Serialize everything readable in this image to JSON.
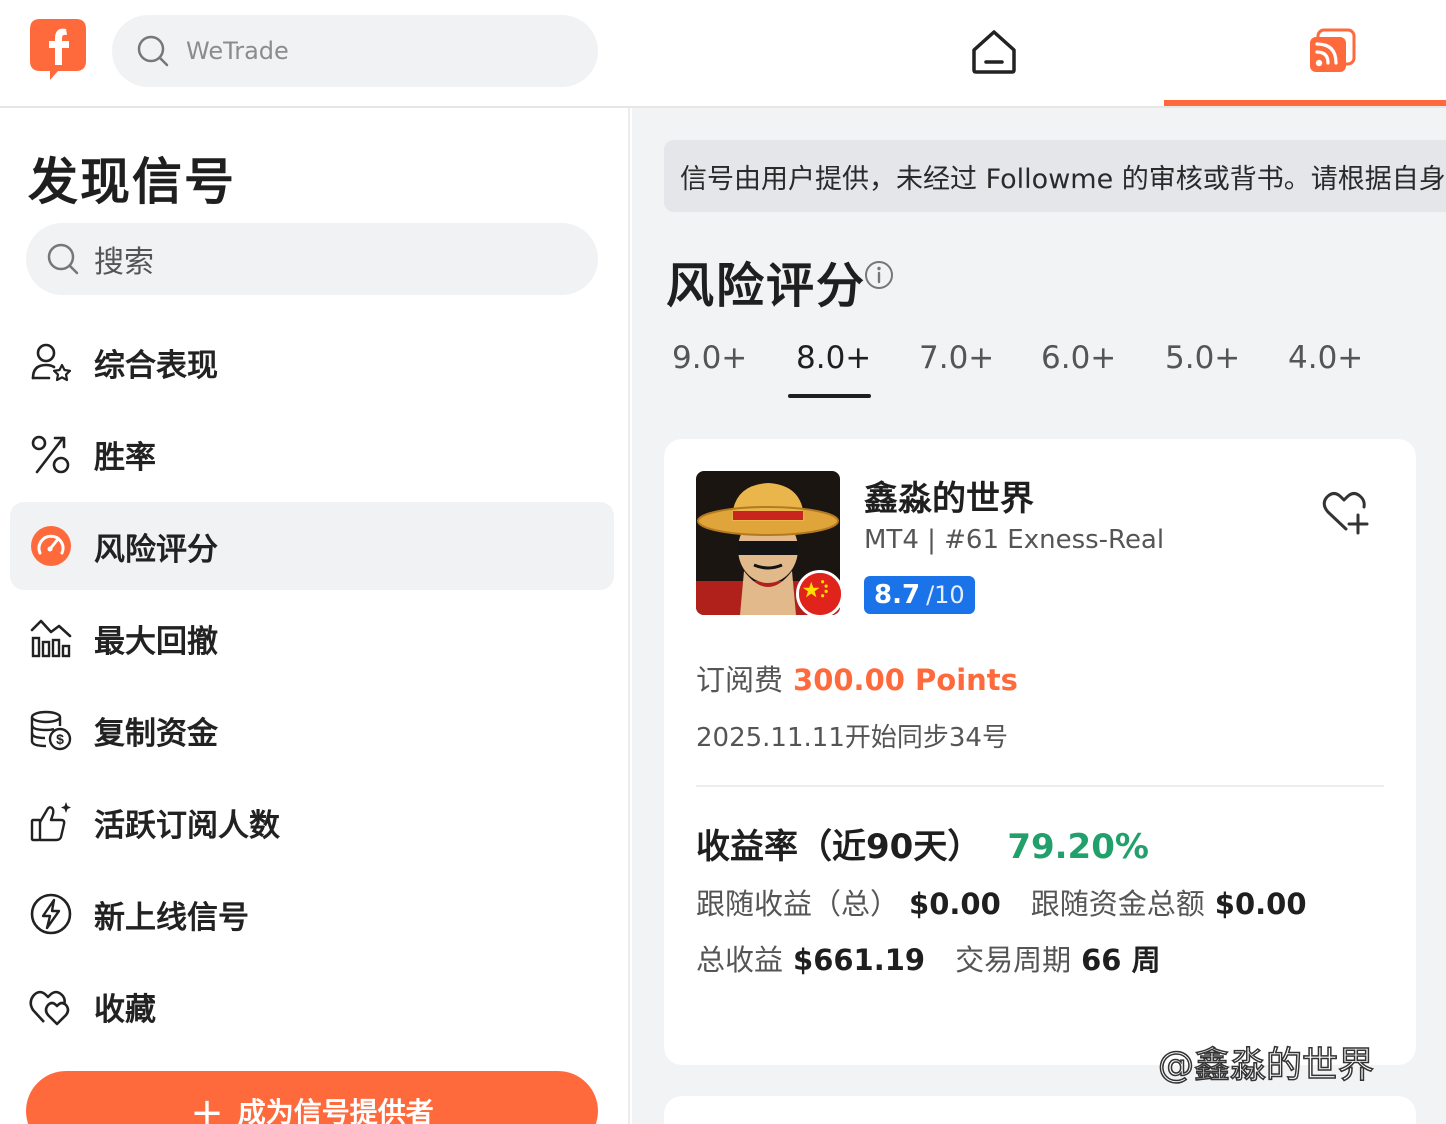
{
  "topbar": {
    "search_placeholder": "WeTrade"
  },
  "sidebar": {
    "title": "发现信号",
    "search_placeholder": "搜索",
    "items": [
      {
        "label": "综合表现",
        "icon": "user-star-icon"
      },
      {
        "label": "胜率",
        "icon": "percent-icon"
      },
      {
        "label": "风险评分",
        "icon": "speedometer-icon",
        "active": true
      },
      {
        "label": "最大回撤",
        "icon": "chart-drawdown-icon"
      },
      {
        "label": "复制资金",
        "icon": "coins-icon"
      },
      {
        "label": "活跃订阅人数",
        "icon": "thumbs-up-icon"
      },
      {
        "label": "新上线信号",
        "icon": "lightning-icon"
      },
      {
        "label": "收藏",
        "icon": "heart-icon"
      }
    ],
    "cta_label": "成为信号提供者"
  },
  "main": {
    "notice": "信号由用户提供，未经过 Followme 的审核或背书。请根据自身",
    "title": "风险评分",
    "score_tabs": [
      "9.0+",
      "8.0+",
      "7.0+",
      "6.0+",
      "5.0+",
      "4.0+"
    ],
    "active_tab": "8.0+",
    "card": {
      "name": "鑫淼的世界",
      "account": "MT4 | #61 Exness-Real",
      "score": "8.7",
      "score_max": "/10",
      "fee_label": "订阅费",
      "fee_value": "300.00 Points",
      "description": "2025.11.11开始同步34号",
      "return_label": "收益率（近90天）",
      "return_value": "79.20%",
      "follow_profit_label": "跟随收益（总）",
      "follow_profit_value": "$0.00",
      "follow_funds_label": "跟随资金总额",
      "follow_funds_value": "$0.00",
      "total_profit_label": "总收益",
      "total_profit_value": "$661.19",
      "period_label": "交易周期",
      "period_value": "66 周"
    }
  },
  "watermark": "@鑫淼的世界",
  "colors": {
    "accent": "#ff6a3d",
    "score_badge": "#1a73e8",
    "positive": "#22a06b"
  }
}
